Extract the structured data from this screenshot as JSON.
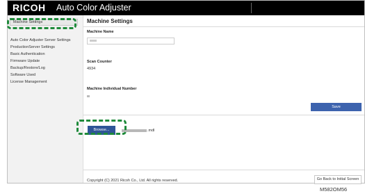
{
  "header": {
    "brand": "RICOH",
    "app_title": "Auto Color Adjuster"
  },
  "sidebar": {
    "items": [
      {
        "label": "Machine Settings",
        "active": true
      },
      {
        "label": "Auto Color Adjuster Server Settings"
      },
      {
        "label": "ProductionServer Settings"
      },
      {
        "label": "Basic Authentication"
      },
      {
        "label": "Firmware Update"
      },
      {
        "label": "Backup/Restore/Log"
      },
      {
        "label": "Software Used"
      },
      {
        "label": "License Management"
      }
    ]
  },
  "main": {
    "title": "Machine Settings",
    "machine_name": {
      "label": "Machine Name"
    },
    "scan_counter": {
      "label": "Scan Counter",
      "value": "4934"
    },
    "individual_number": {
      "label": "Machine Individual Number"
    },
    "save_label": "Save",
    "browse_label": "Browse...",
    "file_suffix": ".mdl",
    "copyright": "Copyright (C) 2021 Ricoh Co., Ltd. All rights reserved.",
    "back_label": "Go Back to Initial Screen"
  },
  "figure_id": "M582OM56",
  "colors": {
    "header": "#000000",
    "primary_button": "#3d63ae",
    "highlight": "#1e8a3a"
  }
}
